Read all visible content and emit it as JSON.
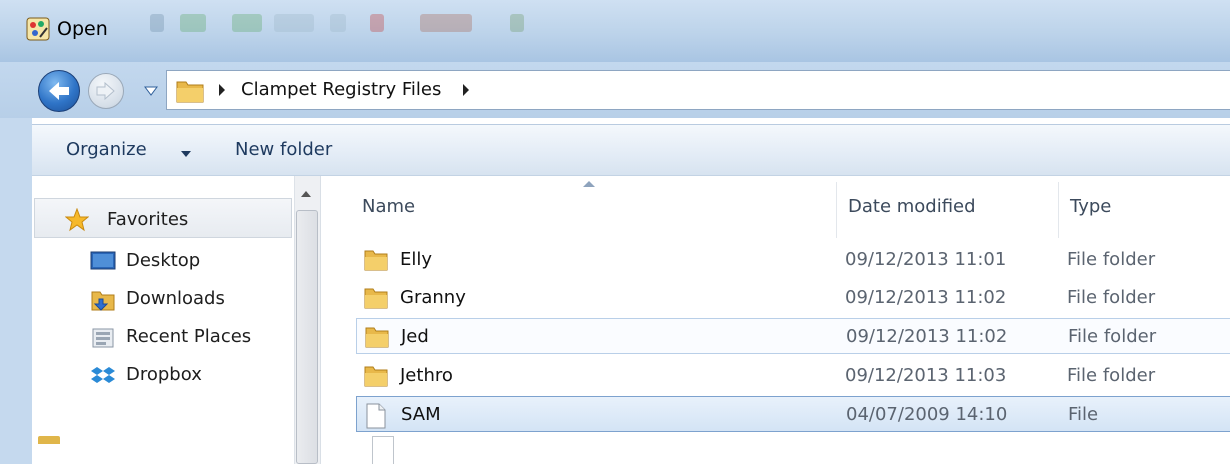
{
  "window": {
    "title": "Open",
    "app_icon": "paint-palette-icon"
  },
  "address_bar": {
    "crumbs": [
      "Clampet Registry Files"
    ],
    "back_icon": "back-arrow-icon",
    "forward_icon": "forward-arrow-icon",
    "location_icon": "folder-icon"
  },
  "toolbar": {
    "organize_label": "Organize",
    "new_folder_label": "New folder"
  },
  "nav": {
    "favorites_label": "Favorites",
    "items": [
      {
        "label": "Desktop",
        "icon": "desktop-icon"
      },
      {
        "label": "Downloads",
        "icon": "downloads-icon"
      },
      {
        "label": "Recent Places",
        "icon": "recent-places-icon"
      },
      {
        "label": "Dropbox",
        "icon": "dropbox-icon"
      }
    ]
  },
  "file_list": {
    "columns": [
      "Name",
      "Date modified",
      "Type"
    ],
    "sorted_by": "Name",
    "rows": [
      {
        "name": "Elly",
        "date": "09/12/2013 11:01",
        "type": "File folder",
        "icon": "folder-icon",
        "state": "normal"
      },
      {
        "name": "Granny",
        "date": "09/12/2013 11:02",
        "type": "File folder",
        "icon": "folder-icon",
        "state": "normal"
      },
      {
        "name": "Jed",
        "date": "09/12/2013 11:02",
        "type": "File folder",
        "icon": "folder-icon",
        "state": "hover"
      },
      {
        "name": "Jethro",
        "date": "09/12/2013 11:03",
        "type": "File folder",
        "icon": "folder-icon",
        "state": "normal"
      },
      {
        "name": "SAM",
        "date": "04/07/2009 14:10",
        "type": "File",
        "icon": "file-icon",
        "state": "selected"
      }
    ]
  },
  "colors": {
    "title_bar": "#bcd3ea",
    "selection": "#d4e4f5",
    "folder": "#e8b84a"
  }
}
